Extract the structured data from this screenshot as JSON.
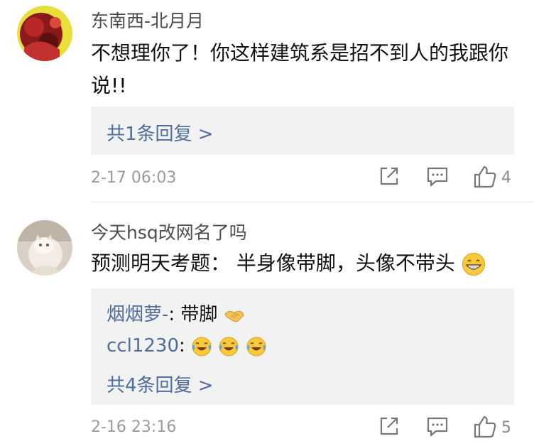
{
  "comments": [
    {
      "username": "东南西-北月月",
      "text": "不想理你了！你这样建筑系是招不到人的我跟你说!!",
      "replies": [],
      "more_replies": "共1条回复 >",
      "time": "2-17 06:03",
      "likes": "4"
    },
    {
      "username": "今天hsq改网名了吗",
      "text": "预测明天考题：  半身像带脚，头像不带头",
      "replies": [
        {
          "user": "烟烟萝-",
          "text": "带脚",
          "emojis": [
            "handshake-emoji"
          ]
        },
        {
          "user": "ccl1230",
          "text": "",
          "emojis": [
            "crying-laughing-emoji",
            "crying-laughing-emoji",
            "crying-laughing-emoji"
          ]
        }
      ],
      "more_replies": "共4条回复 >",
      "time": "2-16 23:16",
      "likes": "5"
    }
  ],
  "icons": {
    "share": "share-icon",
    "comment": "comment-icon",
    "like": "thumbs-up-icon",
    "grin": "grinning-emoji"
  },
  "colors": {
    "link": "#4f6d9c",
    "meta": "#9b9b9b",
    "reply_bg": "#f2f2f2"
  }
}
